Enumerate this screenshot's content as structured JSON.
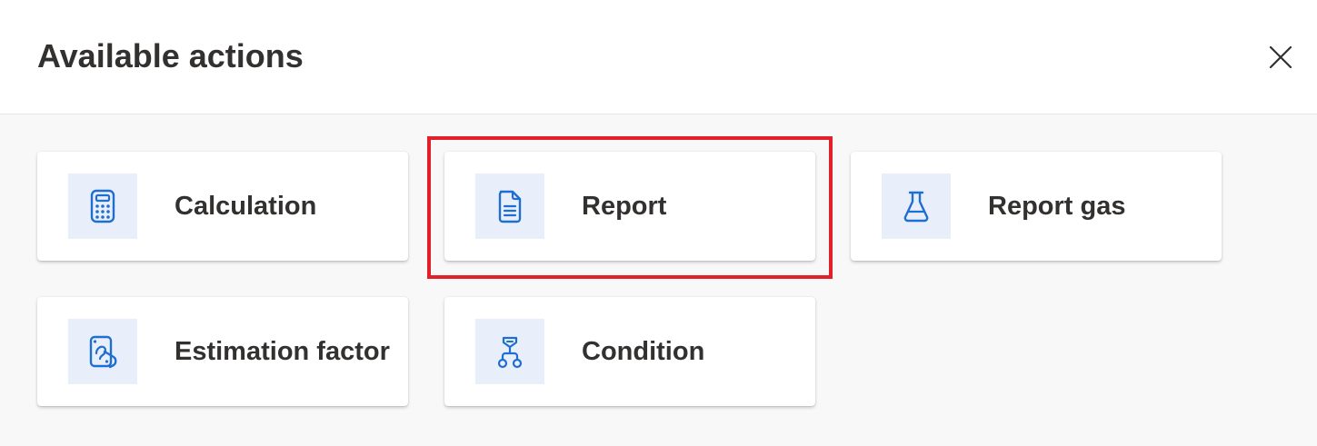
{
  "dialog": {
    "title": "Available actions",
    "close_icon": "close-icon"
  },
  "actions": [
    {
      "label": "Calculation",
      "icon": "calculator-icon"
    },
    {
      "label": "Report",
      "icon": "document-icon"
    },
    {
      "label": "Report gas",
      "icon": "flask-icon"
    },
    {
      "label": "Estimation factor",
      "icon": "estimation-factor-icon"
    },
    {
      "label": "Condition",
      "icon": "flow-branch-icon"
    }
  ],
  "colors": {
    "icon_accent": "#1f6fd1",
    "icon_background": "#e8effb",
    "highlight_border": "#e0212b",
    "content_background": "#f8f8f8"
  }
}
